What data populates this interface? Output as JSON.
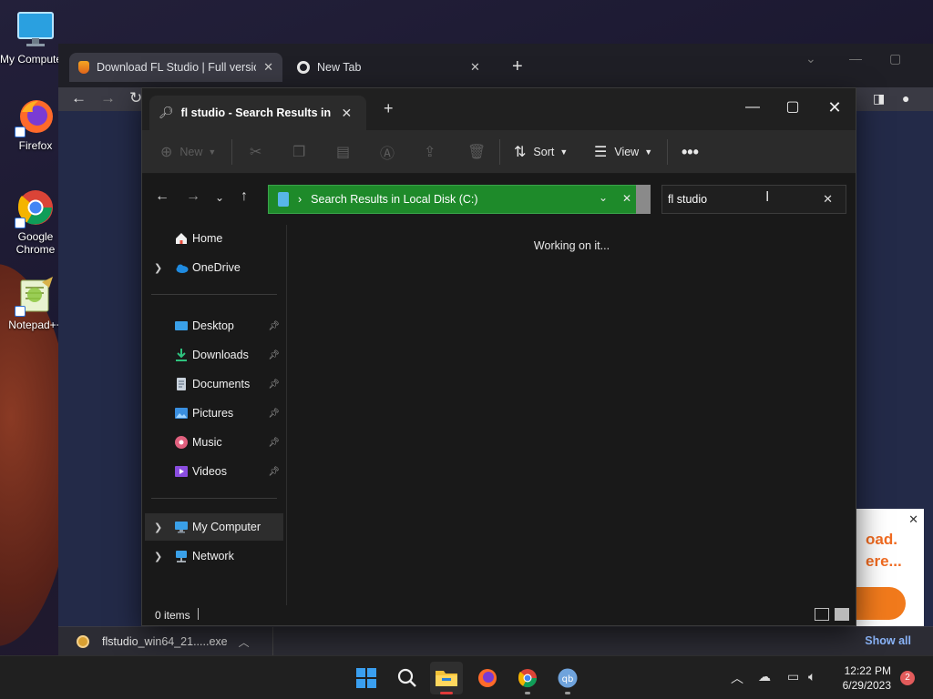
{
  "desktop": {
    "icons": [
      {
        "label": "My Computer"
      },
      {
        "label": "Firefox"
      },
      {
        "label": "Google Chrome"
      },
      {
        "label": "Notepad++"
      }
    ]
  },
  "browser": {
    "tabs": [
      {
        "title": "Download FL Studio | Full version"
      },
      {
        "title": "New Tab"
      }
    ],
    "ad": {
      "line1": "oad.",
      "line2": "ere..."
    },
    "download_bar": {
      "file": "flstudio_win64_21.....exe",
      "show_all": "Show all"
    }
  },
  "explorer": {
    "tab_title": "fl studio - Search Results in Lc",
    "toolbar": {
      "new": "New",
      "sort": "Sort",
      "view": "View"
    },
    "address": "Search Results in Local Disk (C:)",
    "search_value": "fl studio",
    "nav": {
      "home": "Home",
      "onedrive": "OneDrive",
      "desktop": "Desktop",
      "downloads": "Downloads",
      "documents": "Documents",
      "pictures": "Pictures",
      "music": "Music",
      "videos": "Videos",
      "my_computer": "My Computer",
      "network": "Network"
    },
    "main_status": "Working on it...",
    "items_count": "0 items"
  },
  "taskbar": {
    "time": "12:22 PM",
    "date": "6/29/2023",
    "notifications": "2"
  },
  "colors": {
    "address_bg": "#1e8a2a",
    "accent": "#8ab4f8",
    "ad_orange": "#f17a1c"
  }
}
